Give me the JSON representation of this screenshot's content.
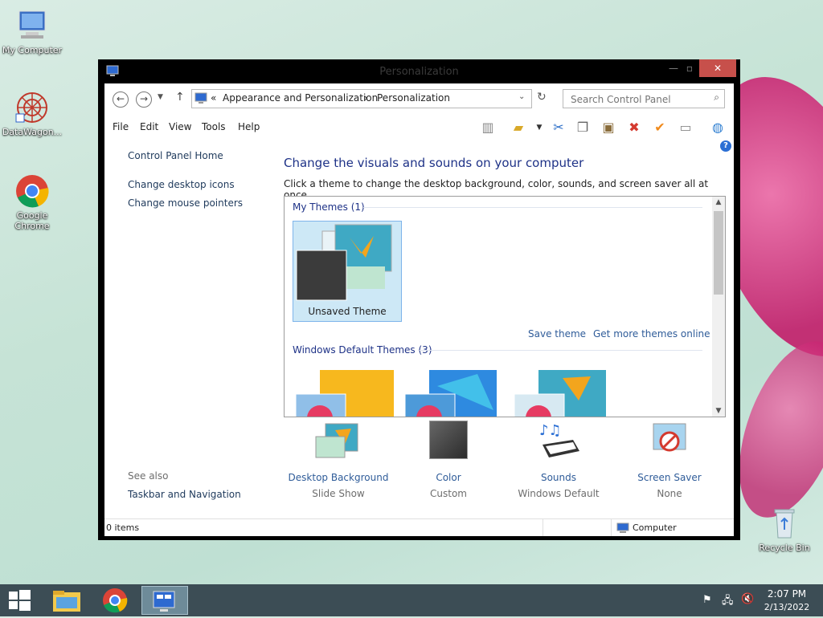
{
  "desktop": {
    "icons": [
      {
        "label": "My Computer"
      },
      {
        "label": "DataWagon..."
      },
      {
        "label": "Google Chrome"
      },
      {
        "label": "Recycle Bin"
      }
    ]
  },
  "window": {
    "title": "Personalization",
    "address": {
      "prefix": "«",
      "crumbs": [
        "Appearance and Personalization",
        "Personalization"
      ],
      "separator": "›"
    },
    "search_placeholder": "Search Control Panel",
    "menu": [
      "File",
      "Edit",
      "View",
      "Tools",
      "Help"
    ],
    "left_pane": {
      "home": "Control Panel Home",
      "links": [
        "Change desktop icons",
        "Change mouse pointers"
      ],
      "see_also_label": "See also",
      "see_also_links": [
        "Taskbar and Navigation"
      ]
    },
    "main": {
      "title": "Change the visuals and sounds on your computer",
      "subtitle": "Click a theme to change the desktop background, color, sounds, and screen saver all at once.",
      "my_themes_header": "My Themes (1)",
      "my_themes": [
        {
          "name": "Unsaved Theme"
        }
      ],
      "save_theme": "Save theme",
      "get_more": "Get more themes online",
      "default_themes_header": "Windows Default Themes (3)"
    },
    "bottom": [
      {
        "name": "Desktop Background",
        "value": "Slide Show"
      },
      {
        "name": "Color",
        "value": "Custom"
      },
      {
        "name": "Sounds",
        "value": "Windows Default"
      },
      {
        "name": "Screen Saver",
        "value": "None"
      }
    ],
    "status": {
      "items": "0 items",
      "location": "Computer"
    },
    "accent_color": "#1e3287",
    "link_color": "#2f5c99"
  },
  "taskbar": {
    "time": "2:07 PM",
    "date": "2/13/2022"
  }
}
